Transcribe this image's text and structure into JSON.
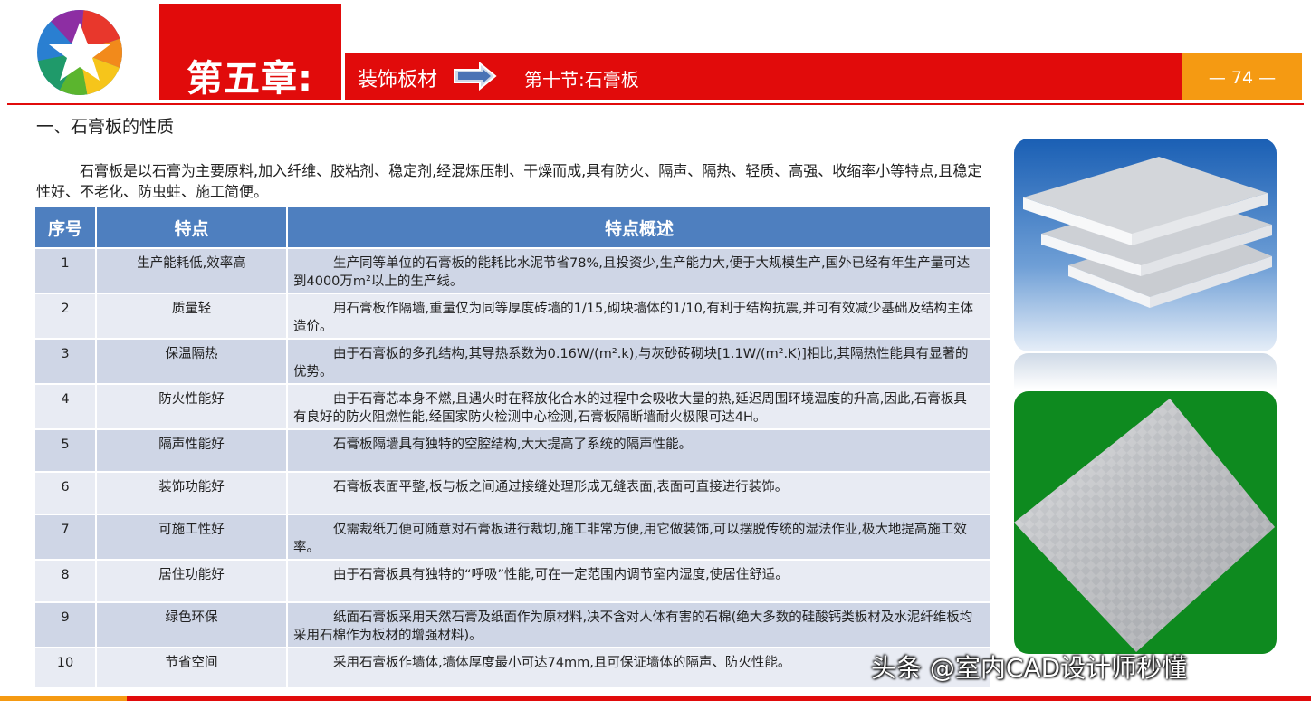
{
  "header": {
    "chapter": "第五章:",
    "section": "装饰板材",
    "subsection": "第十节:石膏板",
    "page": "— 74 —"
  },
  "heading": "一、石膏板的性质",
  "intro": "石膏板是以石膏为主要原料,加入纤维、胶粘剂、稳定剂,经混炼压制、干燥而成,具有防火、隔声、隔热、轻质、高强、收缩率小等特点,且稳定性好、不老化、防虫蛀、施工简便。",
  "table": {
    "headers": [
      "序号",
      "特点",
      "特点概述"
    ],
    "rows": [
      {
        "no": "1",
        "feature": "生产能耗低,效率高",
        "desc": "生产同等单位的石膏板的能耗比水泥节省78%,且投资少,生产能力大,便于大规模生产,国外已经有年生产量可达到4000万m²以上的生产线。"
      },
      {
        "no": "2",
        "feature": "质量轻",
        "desc": "用石膏板作隔墙,重量仅为同等厚度砖墙的1/15,砌块墙体的1/10,有利于结构抗震,并可有效减少基础及结构主体造价。"
      },
      {
        "no": "3",
        "feature": "保温隔热",
        "desc": "由于石膏板的多孔结构,其导热系数为0.16W/(m².k),与灰砂砖砌块[1.1W/(m².K)]相比,其隔热性能具有显著的优势。"
      },
      {
        "no": "4",
        "feature": "防火性能好",
        "desc": "由于石膏芯本身不燃,且遇火时在释放化合水的过程中会吸收大量的热,延迟周围环境温度的升高,因此,石膏板具有良好的防火阻燃性能,经国家防火检测中心检测,石膏板隔断墙耐火极限可达4H。"
      },
      {
        "no": "5",
        "feature": "隔声性能好",
        "desc": "石膏板隔墙具有独特的空腔结构,大大提高了系统的隔声性能。"
      },
      {
        "no": "6",
        "feature": "装饰功能好",
        "desc": "石膏板表面平整,板与板之间通过接缝处理形成无缝表面,表面可直接进行装饰。"
      },
      {
        "no": "7",
        "feature": "可施工性好",
        "desc": "仅需裁纸刀便可随意对石膏板进行裁切,施工非常方便,用它做装饰,可以摆脱传统的湿法作业,极大地提高施工效率。"
      },
      {
        "no": "8",
        "feature": "居住功能好",
        "desc": "由于石膏板具有独特的“呼吸”性能,可在一定范围内调节室内湿度,使居住舒适。"
      },
      {
        "no": "9",
        "feature": "绿色环保",
        "desc": "纸面石膏板采用天然石膏及纸面作为原材料,决不含对人体有害的石棉(绝大多数的硅酸钙类板材及水泥纤维板均采用石棉作为板材的增强材料)。"
      },
      {
        "no": "10",
        "feature": "节省空间",
        "desc": "采用石膏板作墙体,墙体厚度最小可达74mm,且可保证墙体的隔声、防火性能。"
      }
    ]
  },
  "watermark": "头条 @室内CAD设计师秒懂",
  "colors": {
    "red": "#e10b0b",
    "orange": "#f59a12",
    "table_header": "#4e7fbf",
    "row_dark": "#cfd6e6",
    "row_light": "#e8ebf3"
  }
}
